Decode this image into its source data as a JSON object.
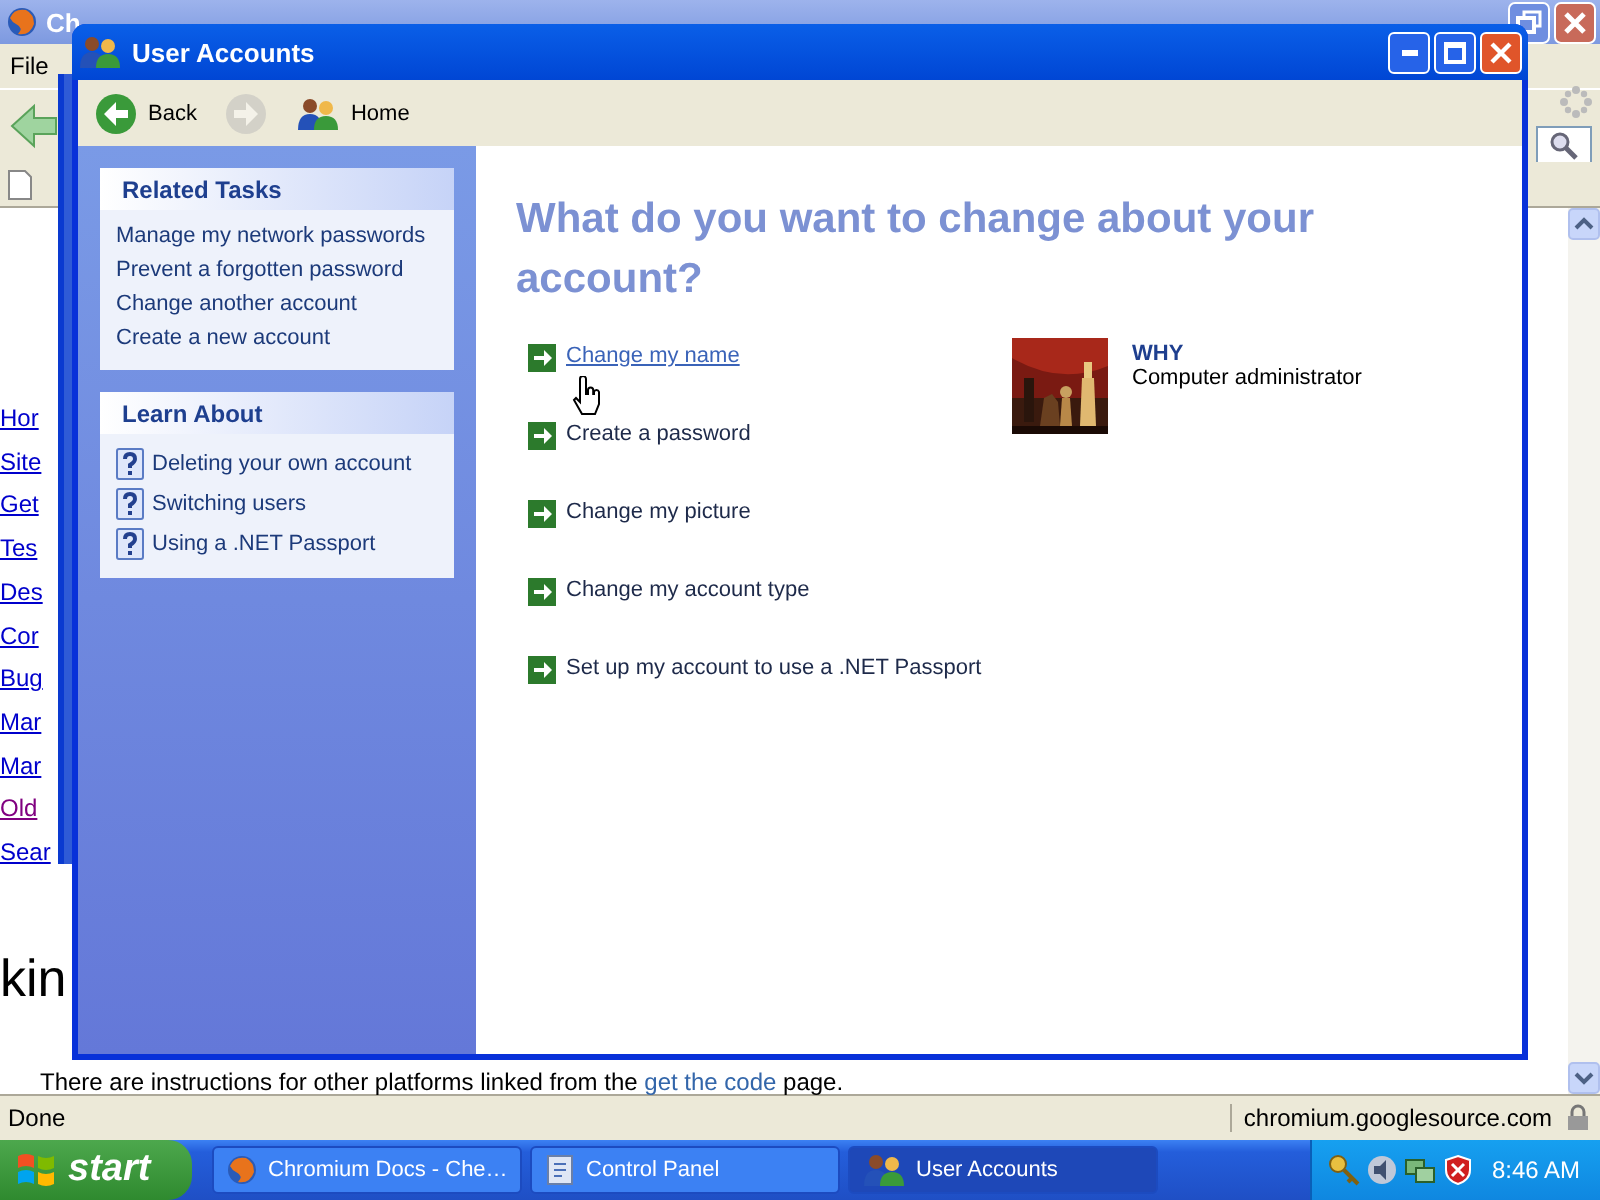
{
  "background_window": {
    "title": "Ch",
    "menu": [
      "File"
    ],
    "links": [
      {
        "text": "Hor",
        "visited": false
      },
      {
        "text": "Site",
        "visited": false
      },
      {
        "text": "Get",
        "visited": false
      },
      {
        "text": "Tes",
        "visited": false
      },
      {
        "text": "Des",
        "visited": false
      },
      {
        "text": "Cor",
        "visited": false
      },
      {
        "text": "Bug",
        "visited": false
      },
      {
        "text": "Mar",
        "visited": false
      },
      {
        "text": "Mar",
        "visited": false
      },
      {
        "text": "Old",
        "visited": true
      },
      {
        "text": "Sear",
        "visited": false
      }
    ],
    "heading": "kin",
    "paragraph": {
      "before": "There are instructions for other platforms linked from the ",
      "link": "get the code",
      "after": " page."
    },
    "status_bar": {
      "status": "Done",
      "domain": "chromium.googlesource.com"
    }
  },
  "window": {
    "title": "User Accounts",
    "toolbar": [
      {
        "kind": "back",
        "label": "Back",
        "disabled": false
      },
      {
        "kind": "forward",
        "disabled": true
      },
      {
        "kind": "home",
        "label": "Home",
        "disabled": false
      }
    ],
    "sidebar": [
      {
        "title": "Related Tasks",
        "kind": "tasks",
        "items": [
          "Manage my network passwords",
          "Prevent a forgotten password",
          "Change another account",
          "Create a new account"
        ]
      },
      {
        "title": "Learn About",
        "kind": "help",
        "items": [
          "Deleting your own account",
          "Switching users",
          "Using a .NET Passport"
        ]
      }
    ],
    "heading": "What do you want to change about your account?",
    "actions": [
      {
        "label": "Change my name",
        "hovered": true
      },
      {
        "label": "Create a password",
        "hovered": false
      },
      {
        "label": "Change my picture",
        "hovered": false
      },
      {
        "label": "Change my account type",
        "hovered": false
      },
      {
        "label": "Set up my account to use a .NET Passport",
        "hovered": false
      }
    ],
    "account": {
      "name": "WHY",
      "type": "Computer administrator"
    }
  },
  "taskbar": {
    "start": "start",
    "tasks": [
      {
        "label": "Chromium Docs - Che…",
        "kind": "browser",
        "selected": false
      },
      {
        "label": "Control Panel",
        "kind": "control",
        "selected": false
      },
      {
        "label": "User Accounts",
        "kind": "users",
        "selected": true
      }
    ],
    "clock": "8:46 AM"
  }
}
